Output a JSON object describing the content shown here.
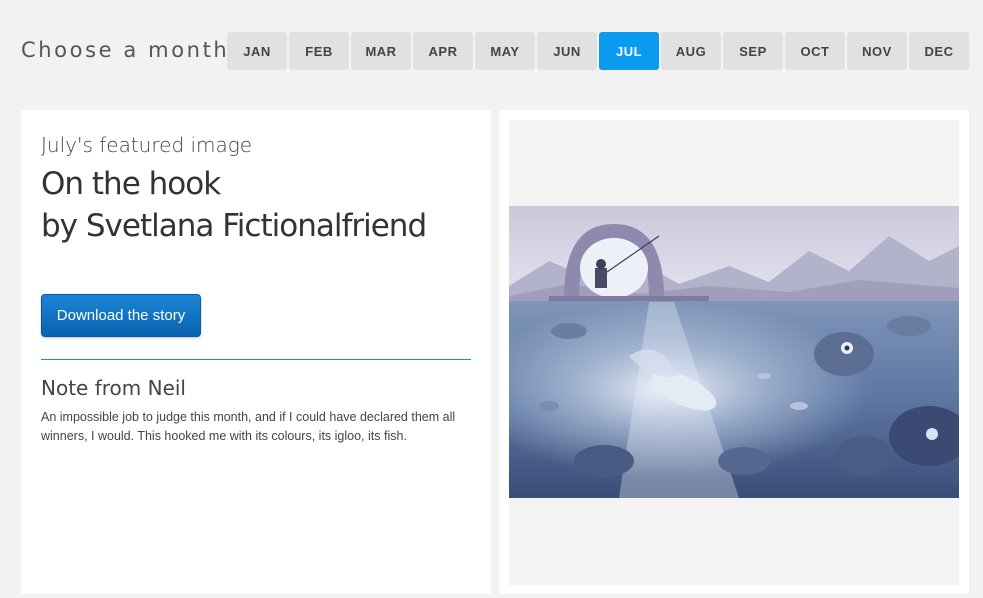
{
  "header": {
    "choose_label": "Choose a month",
    "months": [
      "JAN",
      "FEB",
      "MAR",
      "APR",
      "MAY",
      "JUN",
      "JUL",
      "AUG",
      "SEP",
      "OCT",
      "NOV",
      "DEC"
    ],
    "selected_month": "JUL",
    "accent_color": "#0a9af0"
  },
  "featured": {
    "subtitle": "July's featured image",
    "title_line1": "On the hook",
    "title_line2": "by Svetlana Fictionalfriend",
    "download_label": "Download the story"
  },
  "note": {
    "heading": "Note from Neil",
    "body": "An impossible job to judge this month, and if I could have declared them all winners, I would. This hooked me with its colours, its igloo, its fish."
  }
}
